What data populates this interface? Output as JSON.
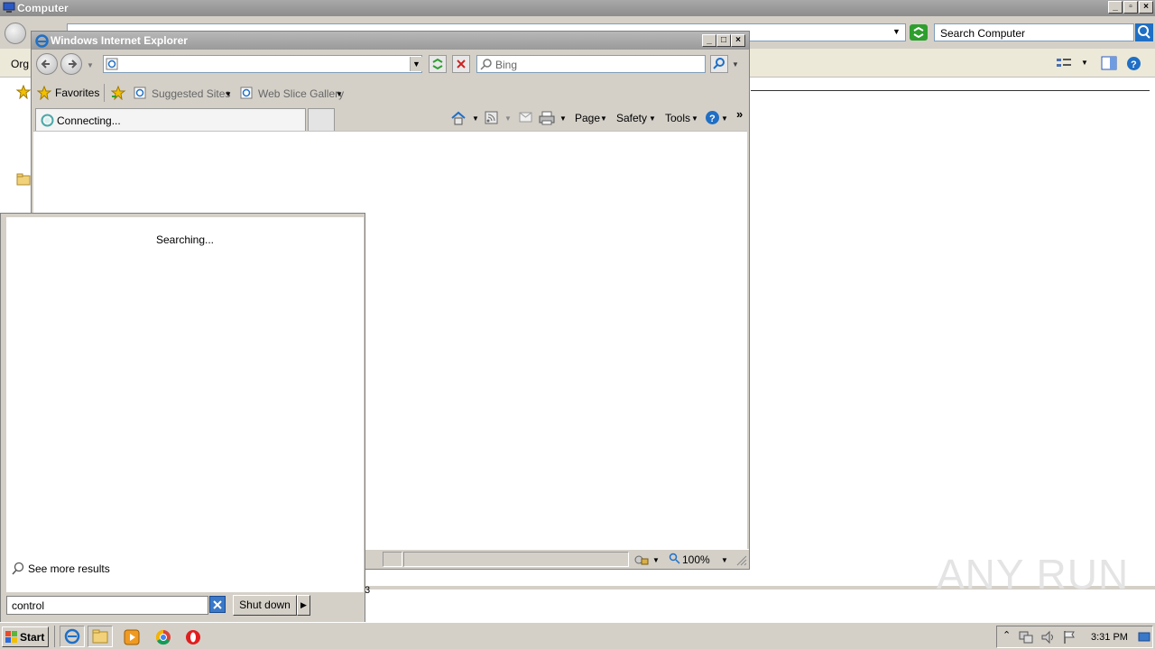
{
  "explorer": {
    "title": "Computer",
    "search_placeholder": "Search Computer",
    "organize_label": "Org",
    "hidden_text_fragment": "3"
  },
  "ie": {
    "title": "Windows Internet Explorer",
    "address_value": "",
    "search_placeholder": "Bing",
    "favorites_label": "Favorites",
    "suggested_sites_label": "Suggested Sites",
    "web_slice_label": "Web Slice Gallery",
    "tab_label": "Connecting...",
    "page_label": "Page",
    "safety_label": "Safety",
    "tools_label": "Tools",
    "zoom_label": "100%"
  },
  "start_menu": {
    "searching_text": "Searching...",
    "see_more_label": "See more results",
    "search_value": "control",
    "shutdown_label": "Shut down"
  },
  "taskbar": {
    "start_label": "Start",
    "clock": "3:31 PM"
  },
  "watermark": "ANY RUN",
  "colors": {
    "title_inactive": "#9a9a9a",
    "chrome": "#d4d0c8",
    "ie_blue": "#1f6fc5",
    "stop_red": "#cc2222",
    "go_green": "#2e9e2e"
  }
}
